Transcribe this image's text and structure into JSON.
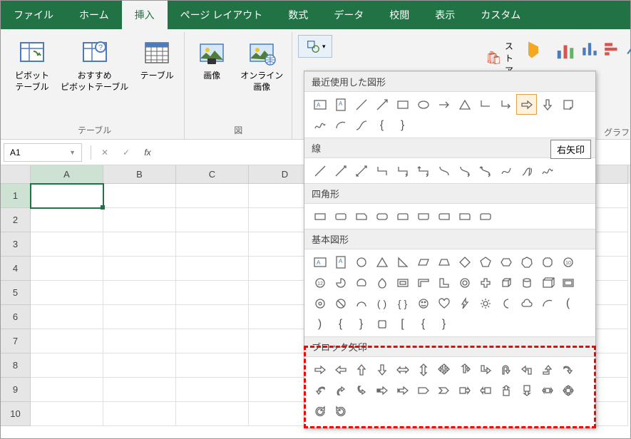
{
  "tabs": [
    "ファイル",
    "ホーム",
    "挿入",
    "ページ レイアウト",
    "数式",
    "データ",
    "校閲",
    "表示",
    "カスタム"
  ],
  "active_tab_index": 2,
  "ribbon": {
    "groups": [
      {
        "label": "テーブル",
        "buttons": [
          {
            "label": "ピボット\nテーブル"
          },
          {
            "label": "おすすめ\nピボットテーブル"
          },
          {
            "label": "テーブル"
          }
        ]
      },
      {
        "label": "図",
        "buttons": [
          {
            "label": "画像"
          },
          {
            "label": "オンライン\n画像"
          }
        ]
      }
    ],
    "store_label": "ストア",
    "chart_group_label": "グラフ"
  },
  "name_box": "A1",
  "grid": {
    "columns": [
      "A",
      "B",
      "C",
      "D"
    ],
    "rows": [
      1,
      2,
      3,
      4,
      5,
      6,
      7,
      8,
      9,
      10
    ],
    "selected": "A1"
  },
  "shapes_panel": {
    "sections": [
      {
        "title": "最近使用した図形",
        "items": [
          "text-box-icon",
          "text-box-v-icon",
          "line-icon",
          "arrow-line-icon",
          "rectangle-icon",
          "ellipse-icon",
          "rarrow-line-icon",
          "triangle-icon",
          "elbow-line-icon",
          "elbow-arrow-icon",
          "arrow-right-icon",
          "arrow-down-icon",
          "note-shape-icon",
          "scribble-icon",
          "arc-icon",
          "curve-icon",
          "brace-l-icon",
          "brace-r-icon"
        ],
        "highlight_index": 10
      },
      {
        "title": "線",
        "items": [
          "line1",
          "line2",
          "line3",
          "line4",
          "line5",
          "line6",
          "line7",
          "line8",
          "line9",
          "line10",
          "line11",
          "line12"
        ]
      },
      {
        "title": "四角形",
        "items": [
          "rect1",
          "rect2",
          "rect3",
          "rect4",
          "rect5",
          "rect6",
          "rect7",
          "rect8",
          "rect9"
        ]
      },
      {
        "title": "基本図形",
        "items": [
          "tb1",
          "tb2",
          "circ1",
          "tri1",
          "rtri1",
          "para1",
          "trap1",
          "dia1",
          "pent1",
          "hex1",
          "hept1",
          "oct1",
          "dec1",
          "dodec1",
          "pie1",
          "chord1",
          "tear1",
          "frame1",
          "halfframe1",
          "lshape1",
          "ring1",
          "plus1",
          "cube1",
          "cyl1",
          "can1",
          "cube2",
          "donut1",
          "noentry1",
          "arc2",
          "bracket-pair1",
          "brace-pair1",
          "smiley1",
          "heart1",
          "lightning1",
          "sun1",
          "moon1",
          "cloud1",
          "arc3",
          "bracket-l",
          "bracket-r",
          "brace-l",
          "brace-r",
          "plaque1",
          "bracket-l2",
          "brace-l2",
          "brace-r2"
        ]
      },
      {
        "title": "ブロック矢印",
        "items": [
          "ba-right",
          "ba-left",
          "ba-up",
          "ba-down",
          "ba-leftright",
          "ba-updown",
          "ba-quad",
          "ba-leftup",
          "ba-bentright",
          "ba-uturn",
          "ba-leftup2",
          "ba-bentup",
          "ba-curvedright",
          "ba-curvedleft",
          "ba-curvedup",
          "ba-curveddown",
          "ba-striped",
          "ba-notched",
          "ba-pentagon",
          "ba-chevron",
          "ba-callout-r",
          "ba-callout-l",
          "ba-callout-u",
          "ba-callout-d",
          "ba-callout-lr",
          "ba-callout-quad",
          "ba-circular",
          "ba-circular2"
        ]
      }
    ]
  },
  "tooltip_text": "右矢印"
}
